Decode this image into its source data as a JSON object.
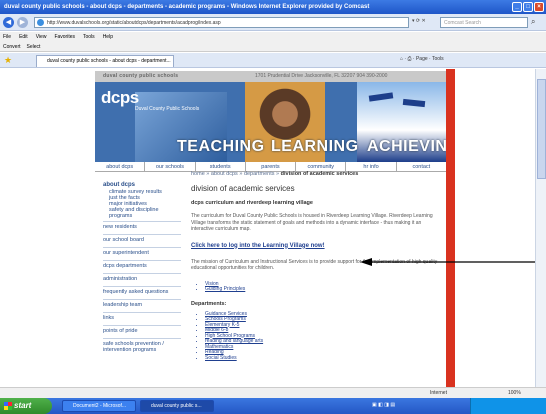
{
  "window": {
    "title": "duval county public schools - about dcps - departments - academic programs - Windows Internet Explorer provided by Comcast",
    "url": "http://www.duvalschools.org/static/aboutdcps/departments/acadprog/index.asp",
    "search_placeholder": "Comcast Search",
    "menu": [
      "File",
      "Edit",
      "View",
      "Favorites",
      "Tools",
      "Help"
    ],
    "links": [
      "Convert",
      "Select"
    ],
    "tab_title": "duval county public schools - about dcps - department...",
    "tab_tools": [
      "Page",
      "Tools"
    ]
  },
  "site": {
    "header_name": "duval county public schools",
    "header_address": "1701 Prudential Drive Jacksonville, FL 32207 904 390-2000",
    "logo": "dcps",
    "logo_sub": "Duval County Public Schools",
    "banner_words": [
      "TEACHING",
      "LEARNING",
      "ACHIEVING"
    ],
    "nav": [
      "about dcps",
      "our schools",
      "students",
      "parents",
      "community",
      "hr info",
      "contact"
    ]
  },
  "sidebar": {
    "section": "about dcps",
    "subitems": [
      "climate survey results",
      "just the facts",
      "major initiatives",
      "safety and discipline programs"
    ],
    "items": [
      "new residents",
      "our school board",
      "our superintendent",
      "dcps departments",
      "administration",
      "frequently asked questions",
      "leadership team",
      "links",
      "points of pride",
      "safe schools prevention / intervention programs"
    ]
  },
  "main": {
    "breadcrumb": [
      "home",
      "about dcps",
      "departments"
    ],
    "breadcrumb_current": "division of academic services",
    "heading": "division of academic services",
    "subheading": "dcps curriculum and riverdeep learning village",
    "intro": "The curriculum for Duval County Public Schools is housed in Riverdeep Learning Village. Riverdeep Learning Village transforms the static statement of goals and methods into a dynamic interface - thus making it an interactive curriculum map.",
    "login_link": "Click here to log into the Learning Village now!",
    "mission": "The mission of Curriculum and Instructional Services is to provide support for the implementation of high quality educational opportunities for children.",
    "vision_links": [
      "Vision",
      "Guiding Principles"
    ],
    "departments_label": "Departments:",
    "departments": [
      "Guidance Services",
      "Schools Programs",
      "Elementary K-5",
      "Middle 6-8",
      "High School Programs",
      "reading and language arts",
      "Mathematics",
      "Reading",
      "Social Studies"
    ]
  },
  "status": {
    "zone": "Internet",
    "zoom": "100%"
  },
  "taskbar": {
    "start": "start",
    "items": [
      "Document2 - Microsof...",
      "duval county public s..."
    ]
  }
}
